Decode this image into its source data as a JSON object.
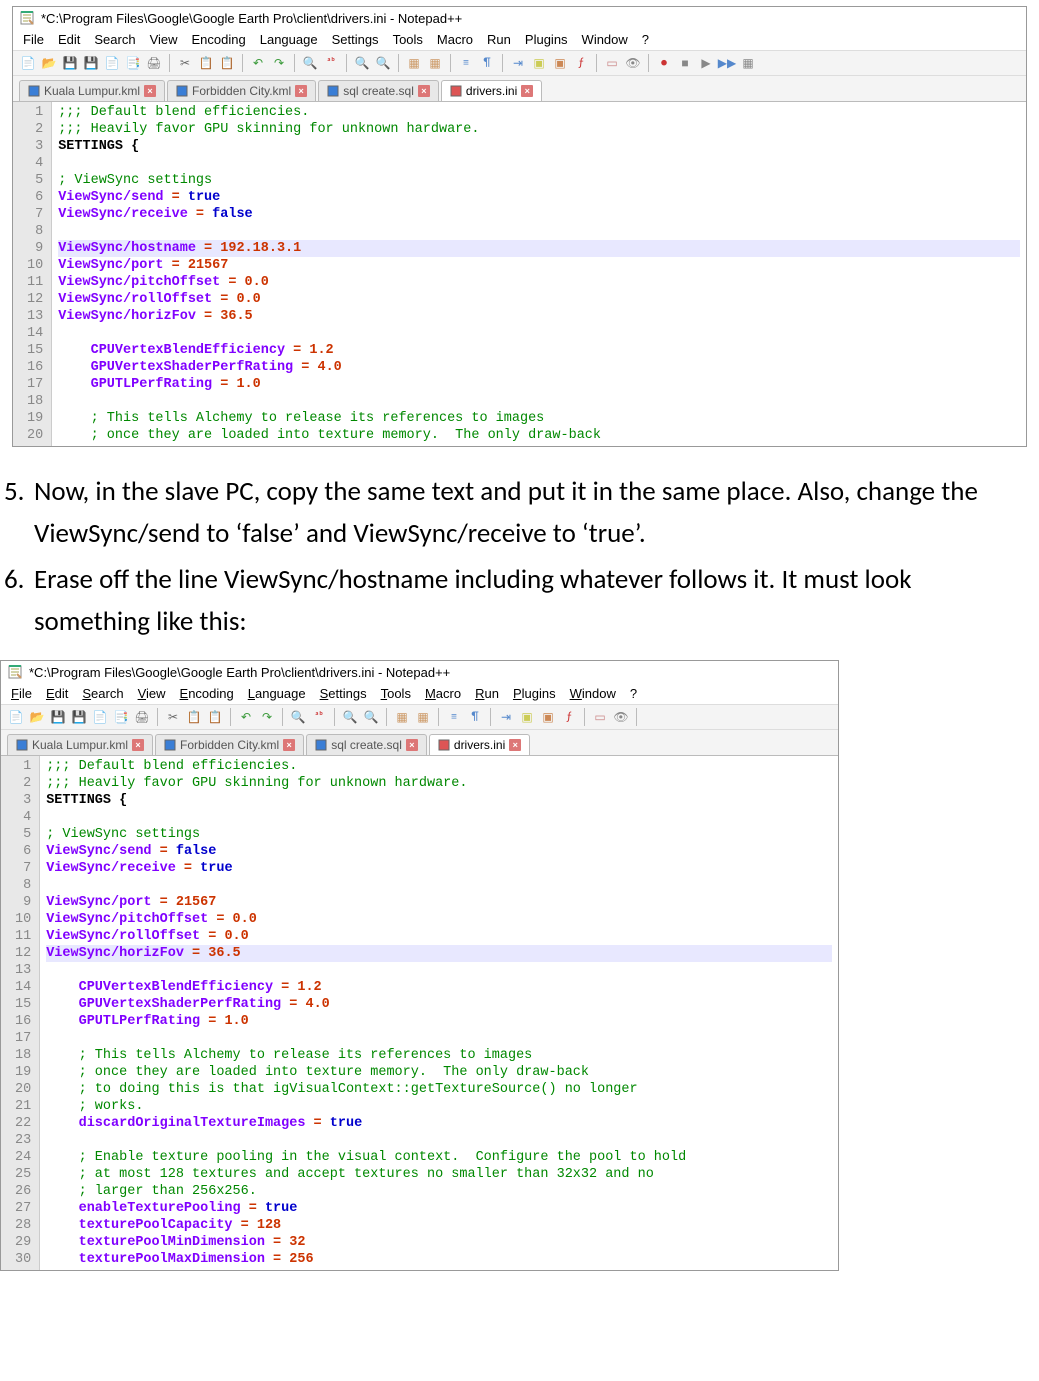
{
  "title1": "*C:\\Program Files\\Google\\Google Earth Pro\\client\\drivers.ini - Notepad++",
  "title2": "*C:\\Program Files\\Google\\Google Earth Pro\\client\\drivers.ini - Notepad++",
  "menus": [
    "File",
    "Edit",
    "Search",
    "View",
    "Encoding",
    "Language",
    "Settings",
    "Tools",
    "Macro",
    "Run",
    "Plugins",
    "Window",
    "?"
  ],
  "tabs": [
    {
      "label": "Kuala Lumpur.kml",
      "active": false
    },
    {
      "label": "Forbidden City.kml",
      "active": false
    },
    {
      "label": "sql create.sql",
      "active": false
    },
    {
      "label": "drivers.ini",
      "active": true
    }
  ],
  "editor1": {
    "highlight": 9,
    "lines": [
      {
        "n": 1,
        "segs": [
          {
            "t": ";;; Default blend efficiencies.",
            "c": "c-comment"
          }
        ]
      },
      {
        "n": 2,
        "segs": [
          {
            "t": ";;; Heavily favor GPU skinning for unknown hardware.",
            "c": "c-comment"
          }
        ]
      },
      {
        "n": 3,
        "segs": [
          {
            "t": "SETTINGS {",
            "c": "c-id"
          }
        ]
      },
      {
        "n": 4,
        "segs": []
      },
      {
        "n": 5,
        "segs": [
          {
            "t": "; ViewSync settings",
            "c": "c-comment"
          }
        ]
      },
      {
        "n": 6,
        "segs": [
          {
            "t": "ViewSync/send",
            "c": "c-key"
          },
          {
            "t": " = ",
            "c": "c-op"
          },
          {
            "t": "true",
            "c": "c-kw"
          }
        ]
      },
      {
        "n": 7,
        "segs": [
          {
            "t": "ViewSync/receive",
            "c": "c-key"
          },
          {
            "t": " = ",
            "c": "c-op"
          },
          {
            "t": "false",
            "c": "c-kw"
          }
        ]
      },
      {
        "n": 8,
        "segs": []
      },
      {
        "n": 9,
        "segs": [
          {
            "t": "ViewSync/hostname",
            "c": "c-key"
          },
          {
            "t": " = ",
            "c": "c-op"
          },
          {
            "t": "192.18.3.1",
            "c": "c-num"
          }
        ]
      },
      {
        "n": 10,
        "segs": [
          {
            "t": "ViewSync/port",
            "c": "c-key"
          },
          {
            "t": " = ",
            "c": "c-op"
          },
          {
            "t": "21567",
            "c": "c-num"
          }
        ]
      },
      {
        "n": 11,
        "segs": [
          {
            "t": "ViewSync/pitchOffset",
            "c": "c-key"
          },
          {
            "t": " = ",
            "c": "c-op"
          },
          {
            "t": "0.0",
            "c": "c-num"
          }
        ]
      },
      {
        "n": 12,
        "segs": [
          {
            "t": "ViewSync/rollOffset",
            "c": "c-key"
          },
          {
            "t": " = ",
            "c": "c-op"
          },
          {
            "t": "0.0",
            "c": "c-num"
          }
        ]
      },
      {
        "n": 13,
        "segs": [
          {
            "t": "ViewSync/horizFov",
            "c": "c-key"
          },
          {
            "t": " = ",
            "c": "c-op"
          },
          {
            "t": "36.5",
            "c": "c-num"
          }
        ]
      },
      {
        "n": 14,
        "segs": []
      },
      {
        "n": 15,
        "segs": [
          {
            "t": "    CPUVertexBlendEfficiency",
            "c": "c-key"
          },
          {
            "t": " = ",
            "c": "c-op"
          },
          {
            "t": "1.2",
            "c": "c-num"
          }
        ]
      },
      {
        "n": 16,
        "segs": [
          {
            "t": "    GPUVertexShaderPerfRating",
            "c": "c-key"
          },
          {
            "t": " = ",
            "c": "c-op"
          },
          {
            "t": "4.0",
            "c": "c-num"
          }
        ]
      },
      {
        "n": 17,
        "segs": [
          {
            "t": "    GPUTLPerfRating",
            "c": "c-key"
          },
          {
            "t": " = ",
            "c": "c-op"
          },
          {
            "t": "1.0",
            "c": "c-num"
          }
        ]
      },
      {
        "n": 18,
        "segs": []
      },
      {
        "n": 19,
        "segs": [
          {
            "t": "    ; This tells Alchemy to release its references to images",
            "c": "c-comment"
          }
        ]
      },
      {
        "n": 20,
        "segs": [
          {
            "t": "    ; once they are loaded into texture memory.  The only draw-back",
            "c": "c-comment"
          }
        ]
      }
    ]
  },
  "step5": "Now, in the slave PC, copy the same text and put it in the same place. Also, change the ViewSync/send to ‘false’ and ViewSync/receive to ‘true’.",
  "step6": "Erase off the line ViewSync/hostname including whatever follows it. It must look something like this:",
  "num5": "5.",
  "num6": "6.",
  "editor2": {
    "highlight": 12,
    "lines": [
      {
        "n": 1,
        "segs": [
          {
            "t": ";;; Default blend efficiencies.",
            "c": "c-comment"
          }
        ]
      },
      {
        "n": 2,
        "segs": [
          {
            "t": ";;; Heavily favor GPU skinning for unknown hardware.",
            "c": "c-comment"
          }
        ]
      },
      {
        "n": 3,
        "segs": [
          {
            "t": "SETTINGS {",
            "c": "c-id"
          }
        ]
      },
      {
        "n": 4,
        "segs": []
      },
      {
        "n": 5,
        "segs": [
          {
            "t": "; ViewSync settings",
            "c": "c-comment"
          }
        ]
      },
      {
        "n": 6,
        "segs": [
          {
            "t": "ViewSync/send",
            "c": "c-key"
          },
          {
            "t": " = ",
            "c": "c-op"
          },
          {
            "t": "false",
            "c": "c-kw"
          }
        ]
      },
      {
        "n": 7,
        "segs": [
          {
            "t": "ViewSync/receive",
            "c": "c-key"
          },
          {
            "t": " = ",
            "c": "c-op"
          },
          {
            "t": "true",
            "c": "c-kw"
          }
        ]
      },
      {
        "n": 8,
        "segs": []
      },
      {
        "n": 9,
        "segs": [
          {
            "t": "ViewSync/port",
            "c": "c-key"
          },
          {
            "t": " = ",
            "c": "c-op"
          },
          {
            "t": "21567",
            "c": "c-num"
          }
        ]
      },
      {
        "n": 10,
        "segs": [
          {
            "t": "ViewSync/pitchOffset",
            "c": "c-key"
          },
          {
            "t": " = ",
            "c": "c-op"
          },
          {
            "t": "0.0",
            "c": "c-num"
          }
        ]
      },
      {
        "n": 11,
        "segs": [
          {
            "t": "ViewSync/rollOffset",
            "c": "c-key"
          },
          {
            "t": " = ",
            "c": "c-op"
          },
          {
            "t": "0.0",
            "c": "c-num"
          }
        ]
      },
      {
        "n": 12,
        "segs": [
          {
            "t": "ViewSync/horizFov",
            "c": "c-key"
          },
          {
            "t": " = ",
            "c": "c-op"
          },
          {
            "t": "36.5",
            "c": "c-num"
          }
        ]
      },
      {
        "n": 13,
        "segs": []
      },
      {
        "n": 14,
        "segs": [
          {
            "t": "    CPUVertexBlendEfficiency",
            "c": "c-key"
          },
          {
            "t": " = ",
            "c": "c-op"
          },
          {
            "t": "1.2",
            "c": "c-num"
          }
        ]
      },
      {
        "n": 15,
        "segs": [
          {
            "t": "    GPUVertexShaderPerfRating",
            "c": "c-key"
          },
          {
            "t": " = ",
            "c": "c-op"
          },
          {
            "t": "4.0",
            "c": "c-num"
          }
        ]
      },
      {
        "n": 16,
        "segs": [
          {
            "t": "    GPUTLPerfRating",
            "c": "c-key"
          },
          {
            "t": " = ",
            "c": "c-op"
          },
          {
            "t": "1.0",
            "c": "c-num"
          }
        ]
      },
      {
        "n": 17,
        "segs": []
      },
      {
        "n": 18,
        "segs": [
          {
            "t": "    ; This tells Alchemy to release its references to images",
            "c": "c-comment"
          }
        ]
      },
      {
        "n": 19,
        "segs": [
          {
            "t": "    ; once they are loaded into texture memory.  The only draw-back",
            "c": "c-comment"
          }
        ]
      },
      {
        "n": 20,
        "segs": [
          {
            "t": "    ; to doing this is that igVisualContext::getTextureSource() no longer",
            "c": "c-comment"
          }
        ]
      },
      {
        "n": 21,
        "segs": [
          {
            "t": "    ; works.",
            "c": "c-comment"
          }
        ]
      },
      {
        "n": 22,
        "segs": [
          {
            "t": "    discardOriginalTextureImages",
            "c": "c-key"
          },
          {
            "t": " = ",
            "c": "c-op"
          },
          {
            "t": "true",
            "c": "c-kw"
          }
        ]
      },
      {
        "n": 23,
        "segs": []
      },
      {
        "n": 24,
        "segs": [
          {
            "t": "    ; Enable texture pooling in the visual context.  Configure the pool to hold",
            "c": "c-comment"
          }
        ]
      },
      {
        "n": 25,
        "segs": [
          {
            "t": "    ; at most 128 textures and accept textures no smaller than 32x32 and no",
            "c": "c-comment"
          }
        ]
      },
      {
        "n": 26,
        "segs": [
          {
            "t": "    ; larger than 256x256.",
            "c": "c-comment"
          }
        ]
      },
      {
        "n": 27,
        "segs": [
          {
            "t": "    enableTexturePooling",
            "c": "c-key"
          },
          {
            "t": " = ",
            "c": "c-op"
          },
          {
            "t": "true",
            "c": "c-kw"
          }
        ]
      },
      {
        "n": 28,
        "segs": [
          {
            "t": "    texturePoolCapacity",
            "c": "c-key"
          },
          {
            "t": " = ",
            "c": "c-op"
          },
          {
            "t": "128",
            "c": "c-num"
          }
        ]
      },
      {
        "n": 29,
        "segs": [
          {
            "t": "    texturePoolMinDimension",
            "c": "c-key"
          },
          {
            "t": " = ",
            "c": "c-op"
          },
          {
            "t": "32",
            "c": "c-num"
          }
        ]
      },
      {
        "n": 30,
        "segs": [
          {
            "t": "    texturePoolMaxDimension",
            "c": "c-key"
          },
          {
            "t": " = ",
            "c": "c-op"
          },
          {
            "t": "256",
            "c": "c-num"
          }
        ]
      }
    ]
  },
  "toolbar_icons": [
    {
      "name": "new-file-icon",
      "sym": "📄",
      "color": "#5a8"
    },
    {
      "name": "open-icon",
      "sym": "📂",
      "color": "#e8a84c"
    },
    {
      "name": "save-icon",
      "sym": "💾",
      "color": "#3a7ed6"
    },
    {
      "name": "save-all-icon",
      "sym": "💾",
      "color": "#3a7ed6"
    },
    {
      "name": "close-icon",
      "sym": "📄",
      "color": "#999"
    },
    {
      "name": "close-all-icon",
      "sym": "📑",
      "color": "#999"
    },
    {
      "name": "print-icon",
      "sym": "🖨",
      "color": "#777"
    },
    {
      "name": "sep"
    },
    {
      "name": "cut-icon",
      "sym": "✂",
      "color": "#666"
    },
    {
      "name": "copy-icon",
      "sym": "📋",
      "color": "#888"
    },
    {
      "name": "paste-icon",
      "sym": "📋",
      "color": "#888"
    },
    {
      "name": "sep"
    },
    {
      "name": "undo-icon",
      "sym": "↶",
      "color": "#3a9a3a"
    },
    {
      "name": "redo-icon",
      "sym": "↷",
      "color": "#3a9a3a"
    },
    {
      "name": "sep"
    },
    {
      "name": "find-icon",
      "sym": "🔍",
      "color": "#555"
    },
    {
      "name": "replace-icon",
      "sym": "ᵃᵇ",
      "color": "#c33"
    },
    {
      "name": "sep"
    },
    {
      "name": "zoom-in-icon",
      "sym": "🔍",
      "color": "#58c"
    },
    {
      "name": "zoom-out-icon",
      "sym": "🔍",
      "color": "#c85"
    },
    {
      "name": "sep"
    },
    {
      "name": "sync-v-icon",
      "sym": "▦",
      "color": "#c96"
    },
    {
      "name": "sync-h-icon",
      "sym": "▦",
      "color": "#c96"
    },
    {
      "name": "sep"
    },
    {
      "name": "wrap-icon",
      "sym": "≡",
      "color": "#58c"
    },
    {
      "name": "all-chars-icon",
      "sym": "¶",
      "color": "#58c"
    },
    {
      "name": "sep"
    },
    {
      "name": "indent-icon",
      "sym": "⇥",
      "color": "#58c"
    },
    {
      "name": "fold-icon",
      "sym": "▣",
      "color": "#cc5"
    },
    {
      "name": "unfold-icon",
      "sym": "▣",
      "color": "#c85"
    },
    {
      "name": "func-list-icon",
      "sym": "ƒ",
      "color": "#c33"
    },
    {
      "name": "sep"
    },
    {
      "name": "doc-map-icon",
      "sym": "▭",
      "color": "#c88"
    },
    {
      "name": "monitor-icon",
      "sym": "👁",
      "color": "#888"
    },
    {
      "name": "sep"
    },
    {
      "name": "record-icon",
      "sym": "●",
      "color": "#c33"
    },
    {
      "name": "stop-icon",
      "sym": "■",
      "color": "#888"
    },
    {
      "name": "play-icon",
      "sym": "▶",
      "color": "#888"
    },
    {
      "name": "fast-icon",
      "sym": "▶▶",
      "color": "#58c"
    },
    {
      "name": "save-macro-icon",
      "sym": "▦",
      "color": "#888"
    }
  ]
}
